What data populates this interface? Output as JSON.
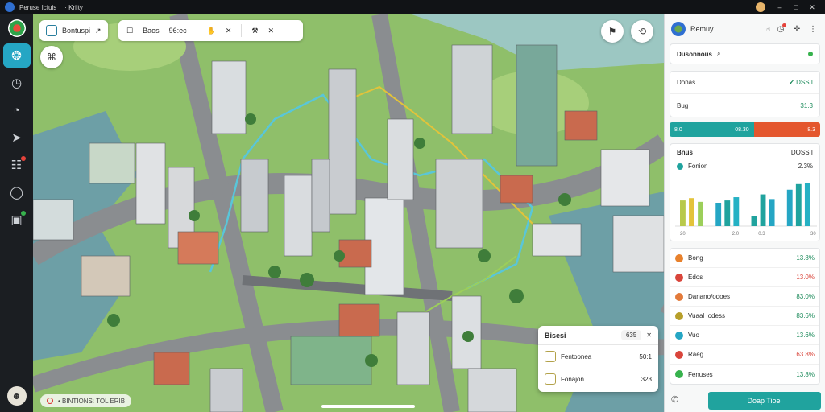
{
  "os_bar": {
    "title_left": "Peruse Icfuis",
    "title_right": "· Kriity",
    "window_controls": [
      "–",
      "□",
      "✕"
    ]
  },
  "rail": {
    "items": [
      {
        "icon": "planet-icon",
        "glyph": "❂"
      },
      {
        "icon": "clock-icon",
        "glyph": "◷"
      },
      {
        "icon": "gauge-icon",
        "glyph": "◔"
      },
      {
        "icon": "send-icon",
        "glyph": "➤"
      },
      {
        "icon": "clipboard-icon",
        "glyph": "☷"
      },
      {
        "icon": "chat-icon",
        "glyph": "◯"
      },
      {
        "icon": "message-icon",
        "glyph": "▣"
      }
    ]
  },
  "map_toolbar": {
    "left_label": "Bontuspi",
    "left_glyph": "↗",
    "main_icon_1": "☐",
    "main_label": "Baos",
    "main_value": "96:ec",
    "main_icon_2": "✋",
    "main_icon_3": "✕",
    "main_icon_4": "⚒",
    "main_icon_5": "✕"
  },
  "map_buttons": {
    "layers": "⚑",
    "route": "⟲",
    "locate": "⌘"
  },
  "bottom_status": {
    "text": "• BINTIONS: TOL ERIB"
  },
  "popup": {
    "title": "Bisesi",
    "chip": "635",
    "close": "✕",
    "rows": [
      {
        "label": "Fentoonea",
        "value": "50:1"
      },
      {
        "label": "Fonajon",
        "value": "323"
      }
    ]
  },
  "panel": {
    "header_title": "Remuy",
    "header_glyph": "☝",
    "header_icons": [
      "◷",
      "✛",
      "⋮"
    ],
    "search": {
      "label": "Dusonnous",
      "icon": "⌕"
    },
    "kv": [
      {
        "key": "Donas",
        "value": "✔ DSSII"
      },
      {
        "key": "Bug",
        "value": "31.3"
      }
    ],
    "progress": {
      "left": "8.0",
      "mid": "08.30",
      "right": "8.3",
      "fraction": 0.56
    },
    "chart_card": {
      "title": "Bnus",
      "value": "DOSSII",
      "legend_label": "Fonion",
      "legend_value": "2.3%"
    },
    "list": [
      {
        "label": "Bong",
        "value": "13.8%",
        "color": "#e8812c"
      },
      {
        "label": "Edos",
        "value": "13.0%",
        "color": "#d9453b"
      },
      {
        "label": "Danano/odoes",
        "value": "83.0%",
        "color": "#e37a3a"
      },
      {
        "label": "Vuaal Iodess",
        "value": "83.6%",
        "color": "#b79f2a"
      },
      {
        "label": "Vuo",
        "value": "13.6%",
        "color": "#25a6c4"
      },
      {
        "label": "Raeg",
        "value": "63.8%",
        "color": "#d9453b"
      },
      {
        "label": "Fenuses",
        "value": "13.8%",
        "color": "#37b24d"
      }
    ],
    "action_button": "Doap Tioei",
    "footer_glyph": "✆"
  },
  "chart_data": {
    "type": "bar",
    "categories": [
      "",
      "",
      "",
      "",
      "",
      "",
      "",
      "",
      "",
      "",
      "",
      "",
      "",
      "",
      ""
    ],
    "series": [
      {
        "values": [
          55,
          60,
          52,
          0,
          50,
          55,
          62,
          0,
          22,
          68,
          58,
          0,
          78,
          90,
          92
        ]
      }
    ],
    "tick_labels": [
      "20",
      "",
      "2.0",
      "0.3",
      "",
      "30"
    ],
    "ylim": [
      0,
      100
    ],
    "colors": [
      "#b8c94a",
      "#e3c33a",
      "#9ccf5a",
      "",
      "#25a6c4",
      "#20a39e",
      "#25b1c4",
      "",
      "#20a39e",
      "#20a39e",
      "#25a6c4",
      "",
      "#25a6c4",
      "#20a39e",
      "#25b1c4"
    ]
  },
  "colors": {
    "accent": "#25a6c4",
    "teal": "#20a39e",
    "danger": "#e4572e"
  }
}
